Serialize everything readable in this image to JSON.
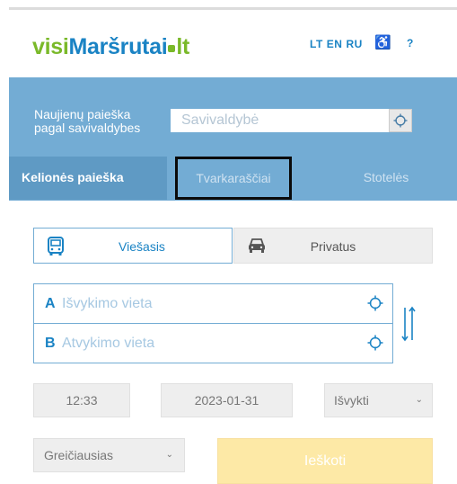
{
  "header": {
    "logo": {
      "part1": "visi",
      "part2": "Maršrutai",
      "part3": "lt"
    },
    "languages": [
      "LT",
      "EN",
      "RU"
    ],
    "help_label": "?"
  },
  "banner": {
    "municipality_label": "Naujienų paieška pagal savivaldybes",
    "municipality_placeholder": "Savivaldybė"
  },
  "tabs": [
    {
      "label": "Kelionės paieška",
      "active": true
    },
    {
      "label": "Tvarkaraščiai",
      "active": false
    },
    {
      "label": "Stotelės",
      "active": false
    }
  ],
  "transport_modes": [
    {
      "label": "Viešasis",
      "icon": "bus-icon",
      "selected": true
    },
    {
      "label": "Privatus",
      "icon": "car-icon",
      "selected": false
    }
  ],
  "route": {
    "from_letter": "A",
    "from_placeholder": "Išvykimo vieta",
    "to_letter": "B",
    "to_placeholder": "Atvykimo vieta"
  },
  "time": "12:33",
  "date": "2023-01-31",
  "departure_mode": {
    "selected": "Išvykti"
  },
  "sort": {
    "selected": "Greičiausias"
  },
  "search_button": "Ieškoti",
  "colors": {
    "brand_green": "#7ab929",
    "brand_blue": "#1a83c4",
    "banner": "#73acd4",
    "active_tab": "#5f9ac4",
    "search_button": "#fde9a6"
  }
}
